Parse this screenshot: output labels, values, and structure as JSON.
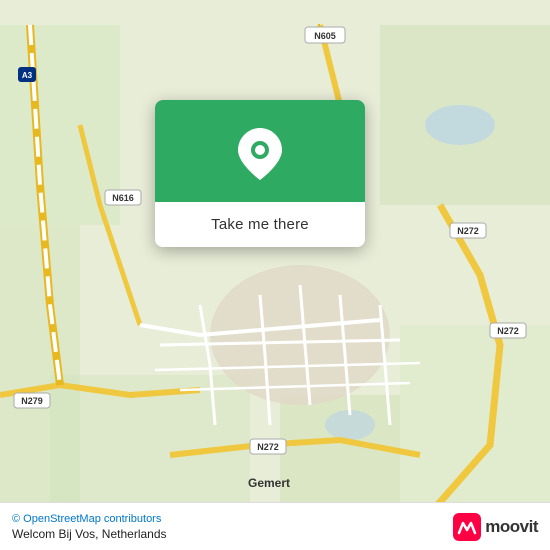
{
  "map": {
    "background_color": "#e8edd8",
    "center_lat": 51.56,
    "center_lng": 5.68,
    "place_label": "Gemert"
  },
  "popup": {
    "button_label": "Take me there",
    "background_color": "#2eaa62"
  },
  "bottom_bar": {
    "attribution_text": "© OpenStreetMap contributors",
    "location_label": "Welcom Bij Vos, Netherlands",
    "moovit_label": "moovit"
  }
}
